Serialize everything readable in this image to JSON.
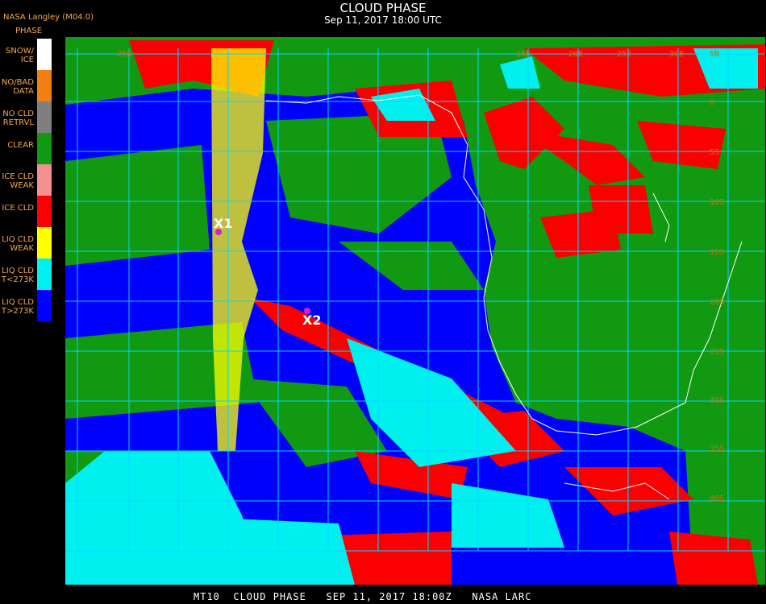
{
  "title": "CLOUD PHASE",
  "subtitle": "Sep 11, 2017 18:00 UTC",
  "org": "NASA Langley (M04.0)",
  "legend_title": "PHASE",
  "legend": [
    {
      "label": "SNOW/\nICE",
      "color": "#ffffff"
    },
    {
      "label": "NO/BAD\nDATA",
      "color": "#f47f11"
    },
    {
      "label": "NO CLD\nRETRVL",
      "color": "#7f7f7f"
    },
    {
      "label": "CLEAR",
      "color": "#119911"
    },
    {
      "label": "ICE CLD\nWEAK",
      "color": "#f59090"
    },
    {
      "label": "ICE CLD",
      "color": "#fa0000"
    },
    {
      "label": "LIQ CLD\nWEAK",
      "color": "#ffff00"
    },
    {
      "label": "LIQ CLD\nT<273K",
      "color": "#00f0f0"
    },
    {
      "label": "LIQ CLD\nT>273K",
      "color": "#0000ff"
    }
  ],
  "markers": [
    {
      "label": "X1"
    },
    {
      "label": "X2"
    }
  ],
  "lon_labels": [
    "25W",
    "15E",
    "20E",
    "25E",
    "30E"
  ],
  "lat_labels": [
    "5N",
    "0",
    "5S",
    "10S",
    "15S",
    "20S",
    "25S",
    "30S",
    "35S",
    "40S"
  ],
  "footer": "MT10  CLOUD PHASE   SEP 11, 2017 18:00Z   NASA LARC",
  "colors": {
    "grid": "#00d8ff",
    "coast": "#ffffff",
    "label": "#e06a00"
  }
}
